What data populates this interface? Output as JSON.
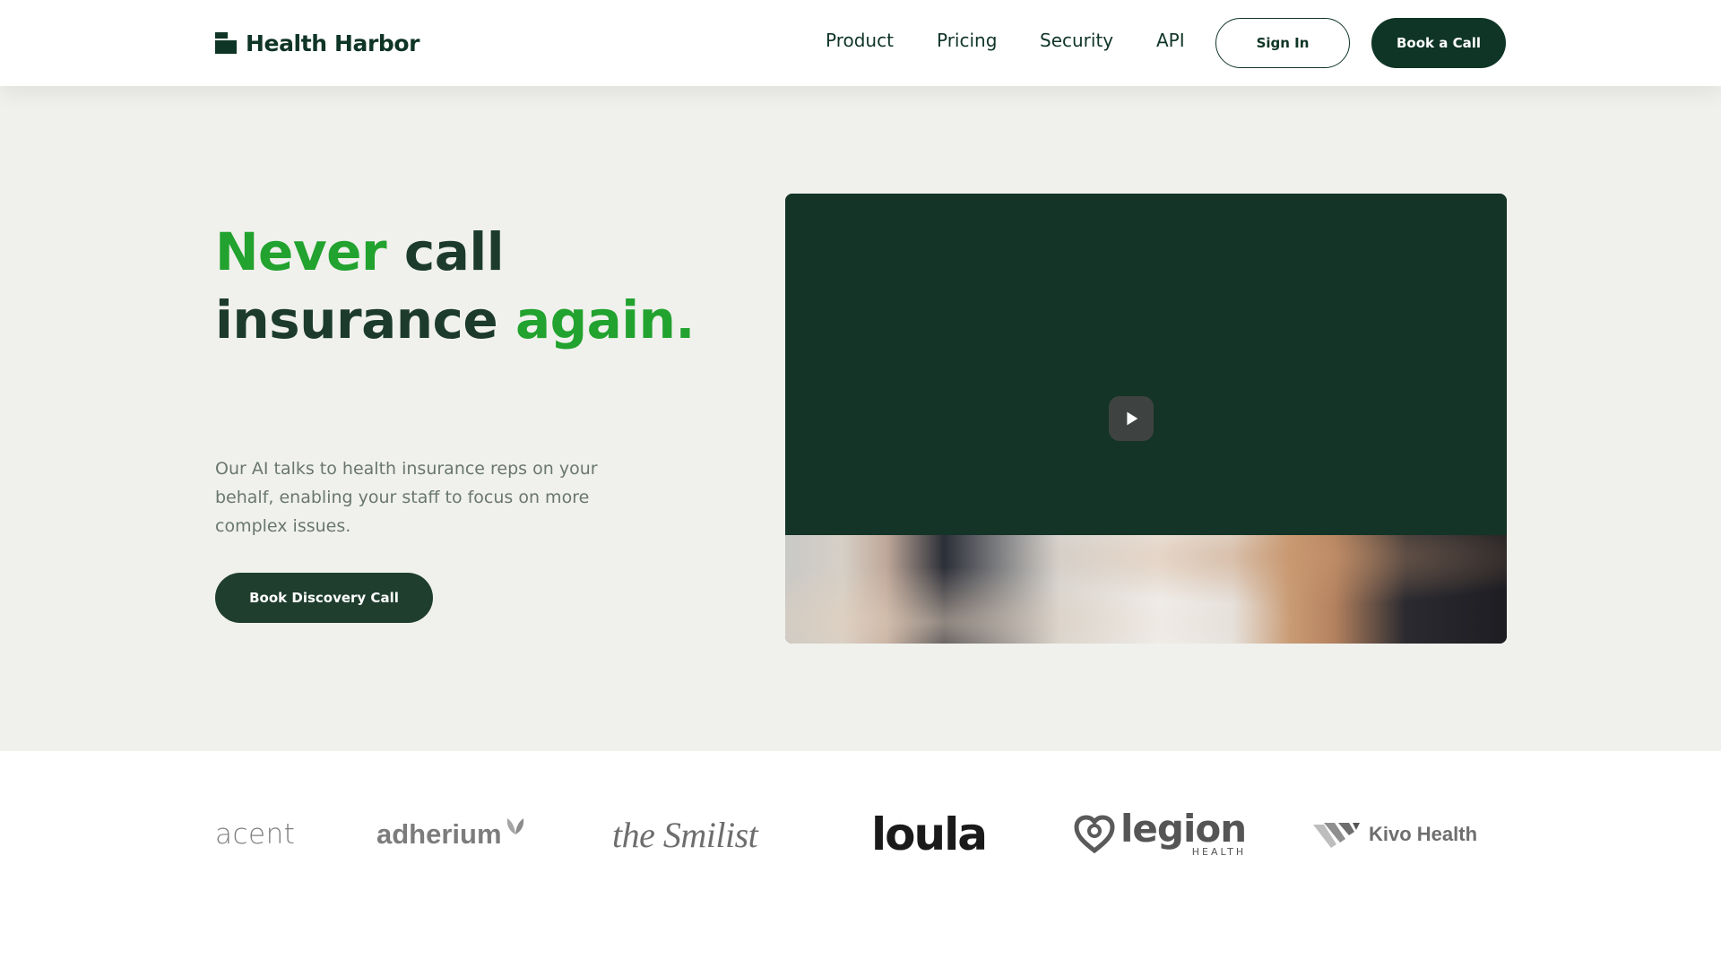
{
  "header": {
    "logo_text": "Health Harbor",
    "nav": [
      {
        "label": "Product"
      },
      {
        "label": "Pricing"
      },
      {
        "label": "Security"
      },
      {
        "label": "API"
      }
    ],
    "sign_in_label": "Sign In",
    "book_call_label": "Book a Call"
  },
  "hero": {
    "headline": {
      "part1": "Never",
      "part2": " call insurance ",
      "part3": "again."
    },
    "subtext": "Our AI talks to health insurance reps on your behalf, enabling your staff to focus on more complex issues.",
    "cta_label": "Book Discovery Call",
    "video": {
      "play_icon": "play-icon"
    }
  },
  "partners": [
    {
      "name": "acent"
    },
    {
      "name": "adherium"
    },
    {
      "name": "the Smilist"
    },
    {
      "name": "loula"
    },
    {
      "name": "legion",
      "sub": "HEALTH"
    },
    {
      "name": "Kivo Health"
    }
  ],
  "colors": {
    "brand_dark": "#0f3526",
    "accent_green": "#22a22e",
    "hero_bg": "#f0f1ed",
    "video_bg": "#133427"
  }
}
